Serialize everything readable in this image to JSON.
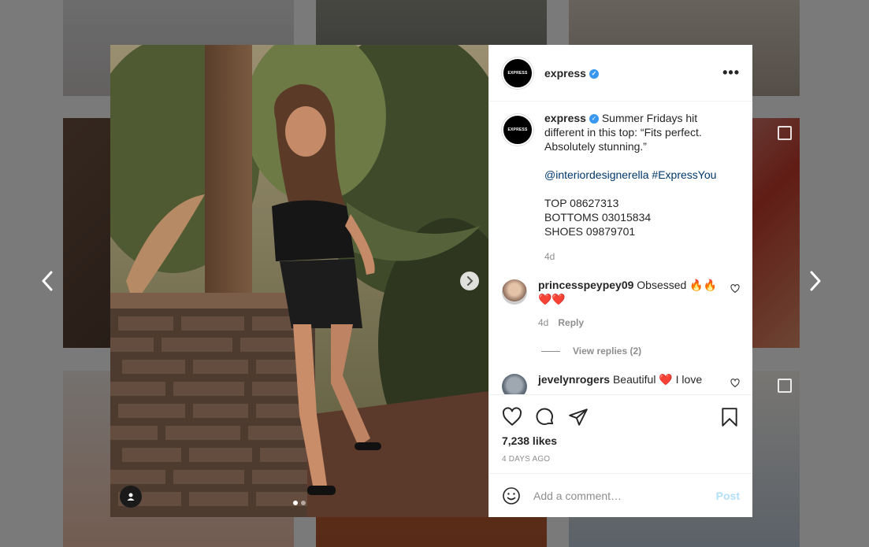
{
  "post": {
    "username": "express",
    "avatar_text": "EXPRESS",
    "verified": true,
    "caption_text": "Summer Fridays hit different in this top: “Fits perfect. Absolutely stunning.”",
    "mention": "@interiordesignerella",
    "hashtag": "#ExpressYou",
    "product_lines": [
      "TOP 08627313",
      "BOTTOMS 03015834",
      "SHOES 09879701"
    ],
    "caption_age": "4d",
    "likes": "7,238 likes",
    "posted_ago": "4 DAYS AGO",
    "photo_dots": 2,
    "active_dot": 0
  },
  "comments": [
    {
      "username": "princesspeypey09",
      "text": "Obsessed 🔥🔥❤️❤️",
      "age": "4d",
      "reply_label": "Reply",
      "view_replies": "View replies (2)"
    },
    {
      "username": "jevelynrogers",
      "text": "Beautiful ❤️ I love"
    }
  ],
  "composer": {
    "placeholder": "Add a comment…",
    "post_label": "Post"
  },
  "icons": {
    "like": "heart-icon",
    "comment": "comment-icon",
    "share": "paper-plane-icon",
    "save": "bookmark-icon",
    "emoji": "emoji-icon",
    "tag": "user-tag-icon",
    "more": "more-options-icon",
    "prev": "chevron-left-icon",
    "next": "chevron-right-icon"
  },
  "colors": {
    "verified_badge": "#3897f0",
    "link": "#00376b",
    "post_button": "#b2dffc"
  }
}
